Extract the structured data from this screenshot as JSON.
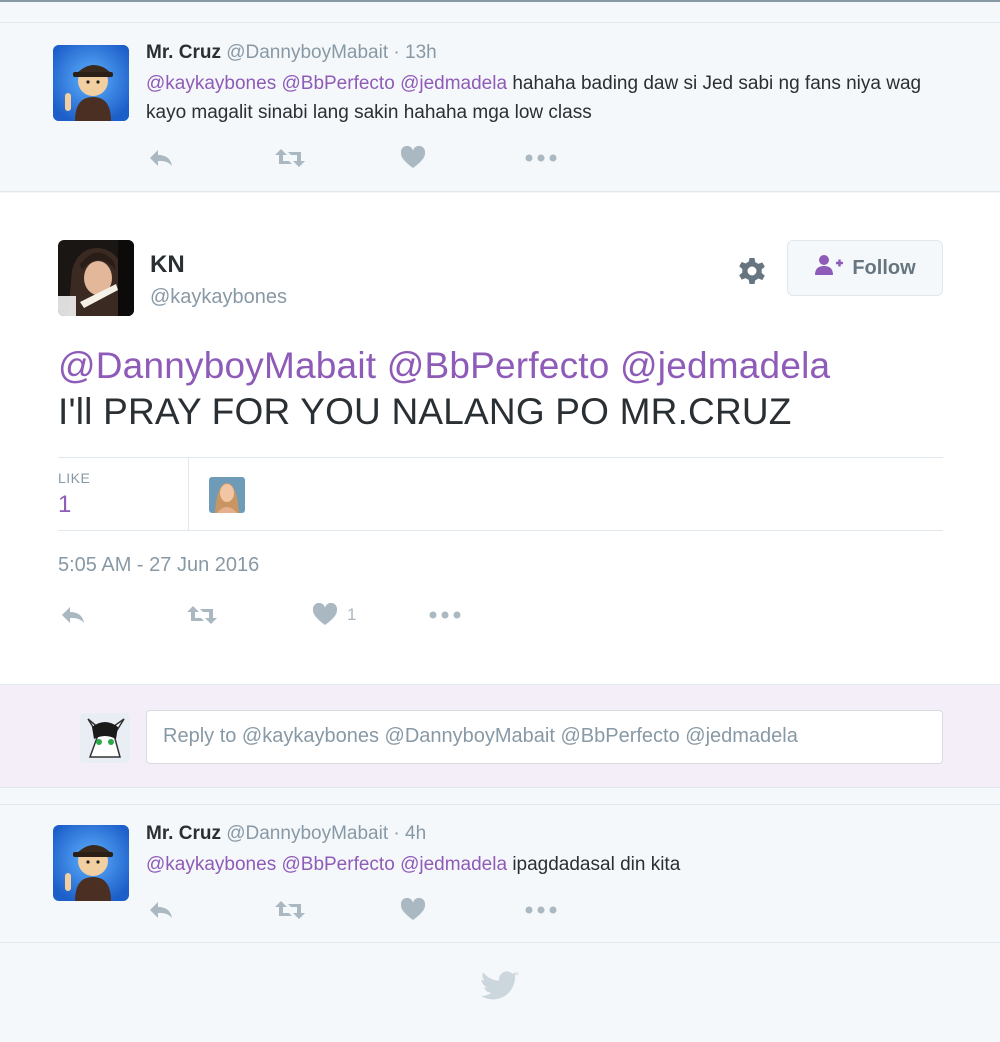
{
  "context_top": {
    "name": "Mr. Cruz",
    "handle": "@DannyboyMabait",
    "separator": "·",
    "time": "13h",
    "mentions": [
      "@kaykaybones",
      "@BbPerfecto",
      "@jedmadela"
    ],
    "text": "hahaha bading daw si Jed sabi ng fans niya wag kayo magalit sinabi lang sakin hahaha mga low class"
  },
  "main_tweet": {
    "name": "KN",
    "handle": "@kaykaybones",
    "follow_label": "Follow",
    "mentions": [
      "@DannyboyMabait",
      "@BbPerfecto",
      "@jedmadela"
    ],
    "text": "I'll PRAY FOR YOU NALANG PO MR.CRUZ",
    "like_label": "LIKE",
    "like_count": "1",
    "timestamp": "5:05 AM - 27 Jun 2016",
    "action_like_count": "1"
  },
  "reply": {
    "placeholder": "Reply to @kaykaybones @DannyboyMabait @BbPerfecto @jedmadela"
  },
  "context_bottom": {
    "name": "Mr. Cruz",
    "handle": "@DannyboyMabait",
    "separator": "·",
    "time": "4h",
    "mentions": [
      "@kaykaybones",
      "@BbPerfecto",
      "@jedmadela"
    ],
    "text": "ipagdadasal din kita"
  },
  "colors": {
    "mention": "#8e5bb8",
    "muted": "#8899a6",
    "action_icon": "#aab8c2",
    "reply_background": "#f3eef8"
  },
  "icons": {
    "reply": "reply-icon",
    "retweet": "retweet-icon",
    "like": "heart-icon",
    "more": "more-icon",
    "settings": "gear-icon",
    "follow": "follow-user-icon",
    "footer": "twitter-bird-icon"
  }
}
